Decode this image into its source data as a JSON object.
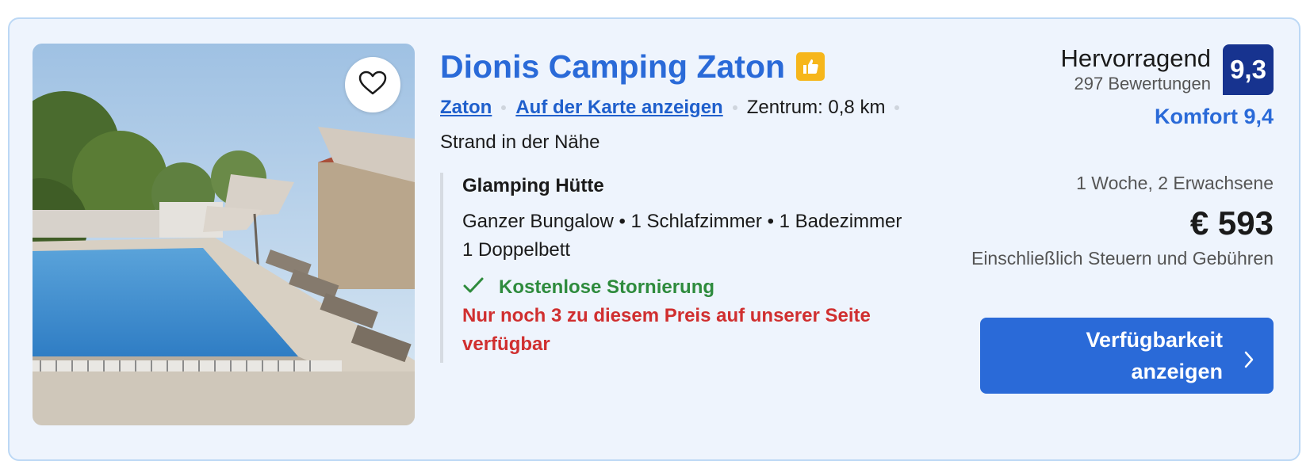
{
  "property": {
    "name": "Dionis Camping Zaton",
    "location_link": "Zaton",
    "map_link": "Auf der Karte anzeigen",
    "distance": "Zentrum: 0,8 km",
    "beach": "Strand in der Nähe",
    "icons": {
      "favorite": "heart-icon",
      "preferred": "thumbs-up-icon"
    }
  },
  "room": {
    "name": "Glamping Hütte",
    "line1": "Ganzer Bungalow • 1 Schlafzimmer • 1 Badezimmer",
    "line2": "1 Doppelbett",
    "cancellation": "Kostenlose Stornierung",
    "scarcity": "Nur noch 3 zu diesem Preis auf unserer Seite verfügbar"
  },
  "rating": {
    "word": "Hervorragend",
    "reviews": "297 Bewertungen",
    "score": "9,3",
    "comfort": "Komfort 9,4"
  },
  "pricing": {
    "stay": "1 Woche, 2 Erwachsene",
    "price": "€ 593",
    "tax_note": "Einschließlich Steuern und Gebühren"
  },
  "cta": {
    "label": "Verfügbarkeit anzeigen"
  },
  "colors": {
    "accent": "#2a6ad8",
    "score_badge": "#17338f",
    "success": "#2e8b3d",
    "urgent": "#d02f2f",
    "card_bg": "#eef4fd",
    "thumb_badge": "#f6b61b"
  }
}
